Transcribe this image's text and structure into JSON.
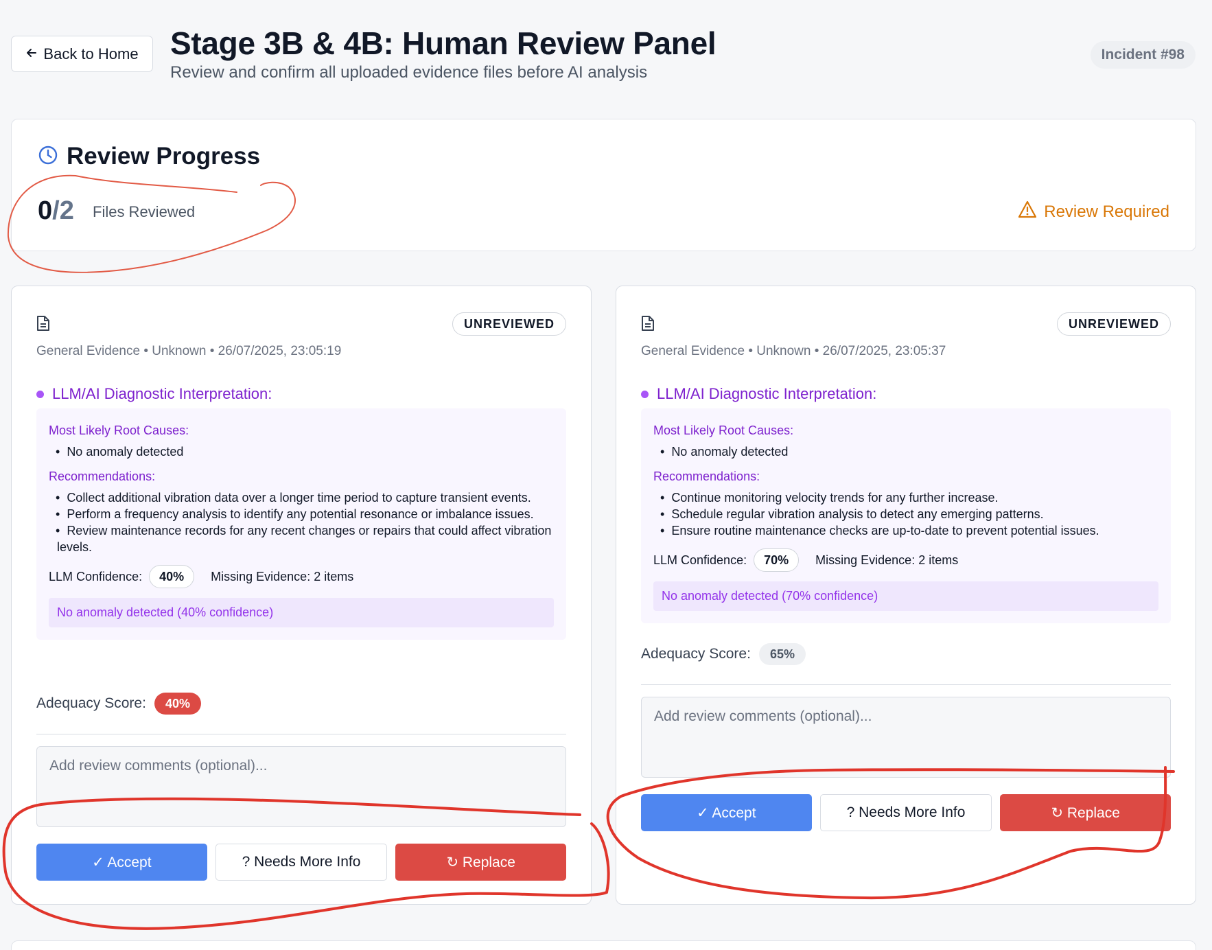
{
  "header": {
    "back_label": "Back to Home",
    "title": "Stage 3B & 4B: Human Review Panel",
    "subtitle": "Review and confirm all uploaded evidence files before AI analysis",
    "incident": "Incident #98"
  },
  "progress": {
    "title": "Review Progress",
    "reviewed": "0",
    "total": "2",
    "label": "Files Reviewed",
    "status": "Review Required"
  },
  "files": [
    {
      "badge": "UNREVIEWED",
      "meta": "General Evidence • Unknown • 26/07/2025, 23:05:19",
      "llm_title": "LLM/AI Diagnostic Interpretation:",
      "root_label": "Most Likely Root Causes:",
      "root_causes": [
        "No anomaly detected"
      ],
      "rec_label": "Recommendations:",
      "recommendations": [
        "Collect additional vibration data over a longer time period to capture transient events.",
        "Perform a frequency analysis to identify any potential resonance or imbalance issues.",
        "Review maintenance records for any recent changes or repairs that could affect vibration levels."
      ],
      "conf_label": "LLM Confidence:",
      "confidence": "40%",
      "missing": "Missing Evidence: 2 items",
      "note": "No anomaly detected (40% confidence)",
      "adequacy_label": "Adequacy Score:",
      "adequacy": "40%",
      "comment_placeholder": "Add review comments (optional)...",
      "accept_label": "✓ Accept",
      "more_label": "? Needs More Info",
      "replace_label": "↻ Replace"
    },
    {
      "badge": "UNREVIEWED",
      "meta": "General Evidence • Unknown • 26/07/2025, 23:05:37",
      "llm_title": "LLM/AI Diagnostic Interpretation:",
      "root_label": "Most Likely Root Causes:",
      "root_causes": [
        "No anomaly detected"
      ],
      "rec_label": "Recommendations:",
      "recommendations": [
        "Continue monitoring velocity trends for any further increase.",
        "Schedule regular vibration analysis to detect any emerging patterns.",
        "Ensure routine maintenance checks are up-to-date to prevent potential issues."
      ],
      "conf_label": "LLM Confidence:",
      "confidence": "70%",
      "missing": "Missing Evidence: 2 items",
      "note": "No anomaly detected (70% confidence)",
      "adequacy_label": "Adequacy Score:",
      "adequacy": "65%",
      "comment_placeholder": "Add review comments (optional)...",
      "accept_label": "✓ Accept",
      "more_label": "? Needs More Info",
      "replace_label": "↻ Replace"
    }
  ],
  "colors": {
    "accent_blue": "#4f86f0",
    "danger_red": "#dc4a44",
    "warning_orange": "#d97706",
    "purple": "#7e22ce",
    "annotation_red": "#e0352b"
  }
}
